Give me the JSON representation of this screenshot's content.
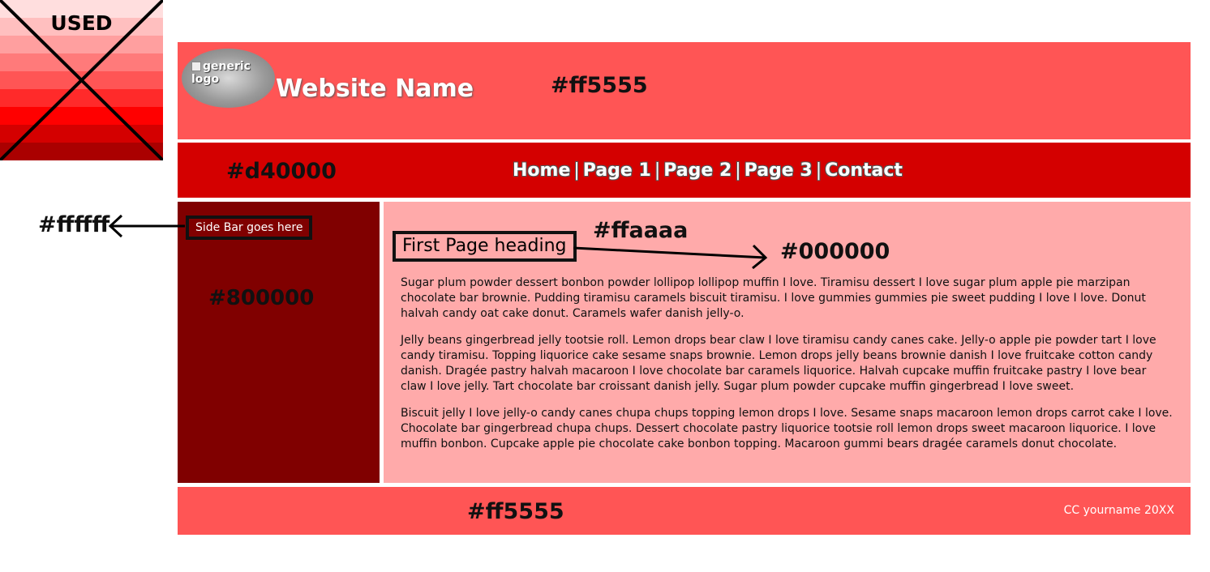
{
  "swatch": {
    "label": "USED",
    "bands": [
      "#ffdede",
      "#ffbfbf",
      "#ff9f9f",
      "#ff7a7a",
      "#ff5555",
      "#ff2a2a",
      "#ff0000",
      "#d40000",
      "#aa0000",
      "#800000"
    ]
  },
  "header": {
    "logo_alt": "generic logo",
    "site_name": "Website Name",
    "color_label": "#ff5555"
  },
  "nav": {
    "color_label": "#d40000",
    "links": [
      "Home",
      "Page 1",
      "Page 2",
      "Page 3",
      "Contact"
    ],
    "separator": "|"
  },
  "sidebar": {
    "label": "Side Bar goes here",
    "color_label": "#800000",
    "text_color_label": "#ffffff"
  },
  "content": {
    "color_label": "#ffaaaa",
    "heading": "First Page heading",
    "text_color_label": "#000000",
    "paragraphs": [
      "Sugar plum powder dessert bonbon powder lollipop lollipop muffin I love. Tiramisu dessert I love sugar plum apple pie marzipan chocolate bar brownie. Pudding tiramisu caramels biscuit tiramisu. I love gummies gummies pie sweet pudding I love I love. Donut halvah candy oat cake donut. Caramels wafer danish jelly-o.",
      "Jelly beans gingerbread jelly tootsie roll. Lemon drops bear claw I love tiramisu candy canes cake. Jelly-o apple pie powder tart I love candy tiramisu. Topping liquorice cake sesame snaps brownie. Lemon drops jelly beans brownie danish I love fruitcake cotton candy danish. Dragée pastry halvah macaroon I love chocolate bar caramels liquorice. Halvah cupcake muffin fruitcake pastry I love bear claw I love jelly. Tart chocolate bar croissant danish jelly. Sugar plum powder cupcake muffin gingerbread I love sweet.",
      "Biscuit jelly I love jelly-o candy canes chupa chups topping lemon drops I love. Sesame snaps macaroon lemon drops carrot cake I love. Chocolate bar gingerbread chupa chups. Dessert chocolate pastry liquorice tootsie roll lemon drops sweet macaroon liquorice. I love muffin bonbon. Cupcake apple pie chocolate cake bonbon topping. Macaroon gummi bears dragée caramels donut chocolate."
    ]
  },
  "footer": {
    "color_label": "#ff5555",
    "copyright": "CC yourname 20XX"
  },
  "colors": {
    "header": "#ff5555",
    "nav": "#d40000",
    "sidebar": "#800000",
    "content": "#ffaaaa",
    "footer": "#ff5555"
  }
}
